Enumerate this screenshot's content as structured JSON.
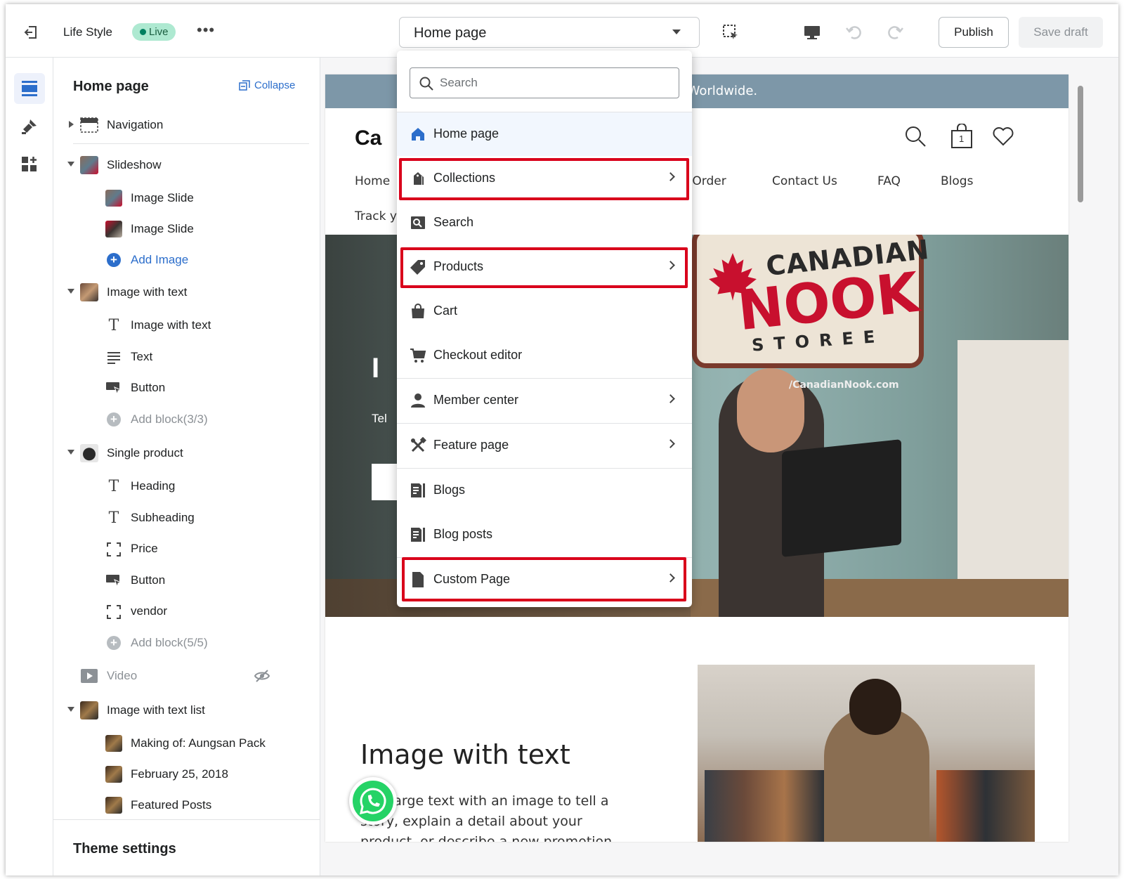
{
  "topbar": {
    "store_name": "Life Style",
    "live_badge": "Live",
    "more_label": "•••",
    "page_selector": "Home page",
    "publish_label": "Publish",
    "save_draft_label": "Save draft"
  },
  "sidebar": {
    "title": "Home page",
    "collapse_label": "Collapse",
    "items": [
      {
        "label": "Navigation"
      },
      {
        "label": "Slideshow"
      },
      {
        "label": "Image Slide"
      },
      {
        "label": "Image Slide"
      },
      {
        "label": "Add Image"
      },
      {
        "label": "Image with text"
      },
      {
        "label": "Image with text"
      },
      {
        "label": "Text"
      },
      {
        "label": "Button"
      },
      {
        "label": "Add block(3/3)"
      },
      {
        "label": "Single product"
      },
      {
        "label": "Heading"
      },
      {
        "label": "Subheading"
      },
      {
        "label": "Price"
      },
      {
        "label": "Button"
      },
      {
        "label": "vendor"
      },
      {
        "label": "Add block(5/5)"
      },
      {
        "label": "Video"
      },
      {
        "label": "Image with text list"
      },
      {
        "label": "Making of: Aungsan Pack"
      },
      {
        "label": "February 25, 2018"
      },
      {
        "label": "Featured Posts"
      }
    ],
    "footer_label": "Theme settings"
  },
  "dropdown": {
    "search_placeholder": "Search",
    "items": [
      {
        "label": "Home page",
        "icon": "home-icon"
      },
      {
        "label": "Collections",
        "icon": "collections-icon"
      },
      {
        "label": "Search",
        "icon": "search-page-icon"
      },
      {
        "label": "Products",
        "icon": "tag-icon"
      },
      {
        "label": "Cart",
        "icon": "bag-icon"
      },
      {
        "label": "Checkout editor",
        "icon": "cart-icon"
      },
      {
        "label": "Member center",
        "icon": "person-icon"
      },
      {
        "label": "Feature page",
        "icon": "tools-icon"
      },
      {
        "label": "Blogs",
        "icon": "blog-icon"
      },
      {
        "label": "Blog posts",
        "icon": "blog-icon"
      },
      {
        "label": "Custom Page",
        "icon": "page-icon"
      }
    ]
  },
  "preview": {
    "announcement": "hipping Worldwide.",
    "logo": "Ca",
    "nav": [
      "Home",
      "r Order",
      "Contact Us",
      "FAQ",
      "Blogs",
      "Track y"
    ],
    "cart_count": "1",
    "hero_heading": "I",
    "hero_text": "Tel",
    "sign_line1": "CANADIAN",
    "sign_line2": "NOOK",
    "sign_line3": "STOREE",
    "sign_url": "/CanadianNook.com",
    "sec2_heading": "Image with text",
    "sec2_text": "large text with an image to tell a story, explain a detail about your product, or describe a new promotion."
  },
  "colors": {
    "accent": "#2c6ecb",
    "live_green": "#008060",
    "highlight_red": "#d9001b",
    "announcement_bg": "#7d97a8"
  }
}
